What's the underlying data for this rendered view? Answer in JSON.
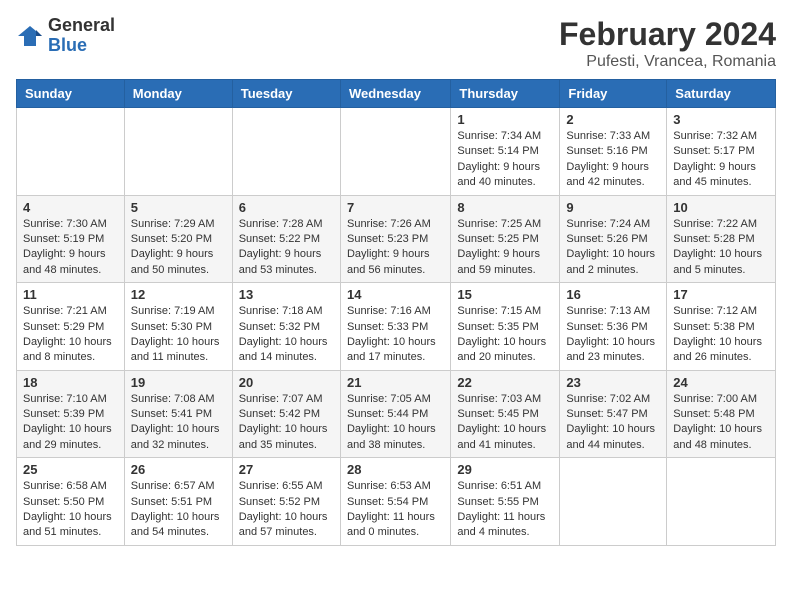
{
  "logo": {
    "general": "General",
    "blue": "Blue"
  },
  "title": {
    "month_year": "February 2024",
    "location": "Pufesti, Vrancea, Romania"
  },
  "headers": [
    "Sunday",
    "Monday",
    "Tuesday",
    "Wednesday",
    "Thursday",
    "Friday",
    "Saturday"
  ],
  "weeks": [
    [
      {
        "day": "",
        "info": ""
      },
      {
        "day": "",
        "info": ""
      },
      {
        "day": "",
        "info": ""
      },
      {
        "day": "",
        "info": ""
      },
      {
        "day": "1",
        "info": "Sunrise: 7:34 AM\nSunset: 5:14 PM\nDaylight: 9 hours\nand 40 minutes."
      },
      {
        "day": "2",
        "info": "Sunrise: 7:33 AM\nSunset: 5:16 PM\nDaylight: 9 hours\nand 42 minutes."
      },
      {
        "day": "3",
        "info": "Sunrise: 7:32 AM\nSunset: 5:17 PM\nDaylight: 9 hours\nand 45 minutes."
      }
    ],
    [
      {
        "day": "4",
        "info": "Sunrise: 7:30 AM\nSunset: 5:19 PM\nDaylight: 9 hours\nand 48 minutes."
      },
      {
        "day": "5",
        "info": "Sunrise: 7:29 AM\nSunset: 5:20 PM\nDaylight: 9 hours\nand 50 minutes."
      },
      {
        "day": "6",
        "info": "Sunrise: 7:28 AM\nSunset: 5:22 PM\nDaylight: 9 hours\nand 53 minutes."
      },
      {
        "day": "7",
        "info": "Sunrise: 7:26 AM\nSunset: 5:23 PM\nDaylight: 9 hours\nand 56 minutes."
      },
      {
        "day": "8",
        "info": "Sunrise: 7:25 AM\nSunset: 5:25 PM\nDaylight: 9 hours\nand 59 minutes."
      },
      {
        "day": "9",
        "info": "Sunrise: 7:24 AM\nSunset: 5:26 PM\nDaylight: 10 hours\nand 2 minutes."
      },
      {
        "day": "10",
        "info": "Sunrise: 7:22 AM\nSunset: 5:28 PM\nDaylight: 10 hours\nand 5 minutes."
      }
    ],
    [
      {
        "day": "11",
        "info": "Sunrise: 7:21 AM\nSunset: 5:29 PM\nDaylight: 10 hours\nand 8 minutes."
      },
      {
        "day": "12",
        "info": "Sunrise: 7:19 AM\nSunset: 5:30 PM\nDaylight: 10 hours\nand 11 minutes."
      },
      {
        "day": "13",
        "info": "Sunrise: 7:18 AM\nSunset: 5:32 PM\nDaylight: 10 hours\nand 14 minutes."
      },
      {
        "day": "14",
        "info": "Sunrise: 7:16 AM\nSunset: 5:33 PM\nDaylight: 10 hours\nand 17 minutes."
      },
      {
        "day": "15",
        "info": "Sunrise: 7:15 AM\nSunset: 5:35 PM\nDaylight: 10 hours\nand 20 minutes."
      },
      {
        "day": "16",
        "info": "Sunrise: 7:13 AM\nSunset: 5:36 PM\nDaylight: 10 hours\nand 23 minutes."
      },
      {
        "day": "17",
        "info": "Sunrise: 7:12 AM\nSunset: 5:38 PM\nDaylight: 10 hours\nand 26 minutes."
      }
    ],
    [
      {
        "day": "18",
        "info": "Sunrise: 7:10 AM\nSunset: 5:39 PM\nDaylight: 10 hours\nand 29 minutes."
      },
      {
        "day": "19",
        "info": "Sunrise: 7:08 AM\nSunset: 5:41 PM\nDaylight: 10 hours\nand 32 minutes."
      },
      {
        "day": "20",
        "info": "Sunrise: 7:07 AM\nSunset: 5:42 PM\nDaylight: 10 hours\nand 35 minutes."
      },
      {
        "day": "21",
        "info": "Sunrise: 7:05 AM\nSunset: 5:44 PM\nDaylight: 10 hours\nand 38 minutes."
      },
      {
        "day": "22",
        "info": "Sunrise: 7:03 AM\nSunset: 5:45 PM\nDaylight: 10 hours\nand 41 minutes."
      },
      {
        "day": "23",
        "info": "Sunrise: 7:02 AM\nSunset: 5:47 PM\nDaylight: 10 hours\nand 44 minutes."
      },
      {
        "day": "24",
        "info": "Sunrise: 7:00 AM\nSunset: 5:48 PM\nDaylight: 10 hours\nand 48 minutes."
      }
    ],
    [
      {
        "day": "25",
        "info": "Sunrise: 6:58 AM\nSunset: 5:50 PM\nDaylight: 10 hours\nand 51 minutes."
      },
      {
        "day": "26",
        "info": "Sunrise: 6:57 AM\nSunset: 5:51 PM\nDaylight: 10 hours\nand 54 minutes."
      },
      {
        "day": "27",
        "info": "Sunrise: 6:55 AM\nSunset: 5:52 PM\nDaylight: 10 hours\nand 57 minutes."
      },
      {
        "day": "28",
        "info": "Sunrise: 6:53 AM\nSunset: 5:54 PM\nDaylight: 11 hours\nand 0 minutes."
      },
      {
        "day": "29",
        "info": "Sunrise: 6:51 AM\nSunset: 5:55 PM\nDaylight: 11 hours\nand 4 minutes."
      },
      {
        "day": "",
        "info": ""
      },
      {
        "day": "",
        "info": ""
      }
    ]
  ]
}
